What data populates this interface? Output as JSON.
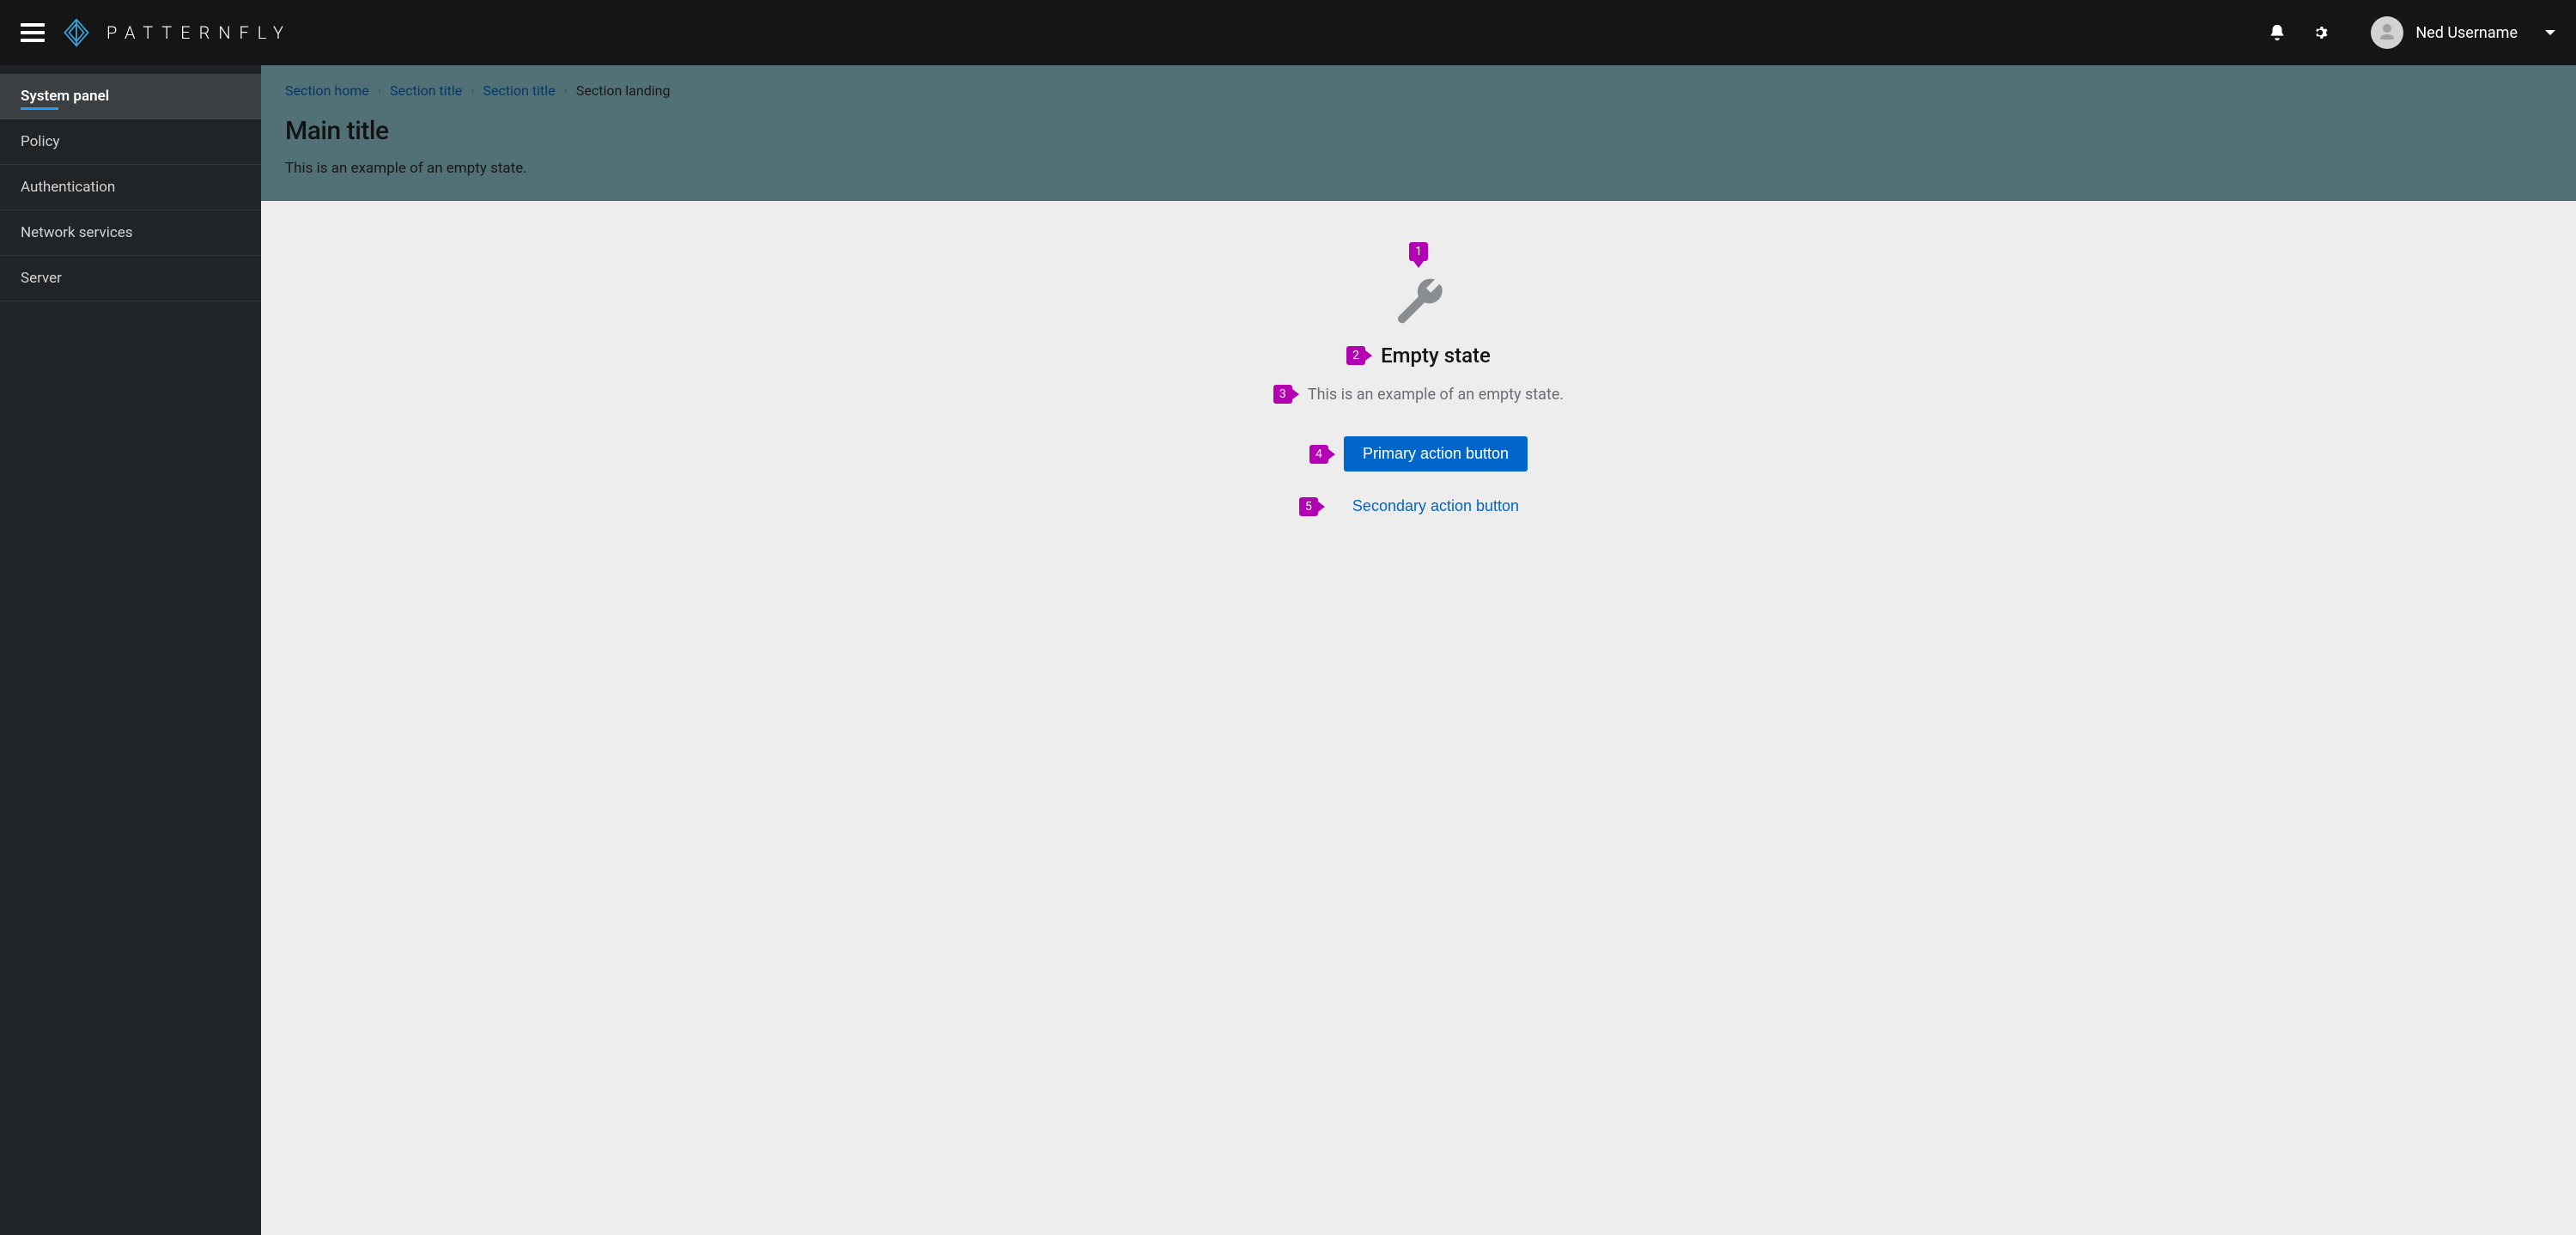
{
  "brand": {
    "name": "PATTERNFLY"
  },
  "header": {
    "user_name": "Ned Username"
  },
  "sidebar": {
    "items": [
      {
        "label": "System panel",
        "active": true
      },
      {
        "label": "Policy",
        "active": false
      },
      {
        "label": "Authentication",
        "active": false
      },
      {
        "label": "Network services",
        "active": false
      },
      {
        "label": "Server",
        "active": false
      }
    ]
  },
  "breadcrumb": {
    "items": [
      {
        "label": "Section home",
        "link": true
      },
      {
        "label": "Section title",
        "link": true
      },
      {
        "label": "Section title",
        "link": true
      },
      {
        "label": "Section landing",
        "link": false
      }
    ]
  },
  "page": {
    "title": "Main title",
    "subtitle": "This is an example of an empty state."
  },
  "empty_state": {
    "heading": "Empty state",
    "body": "This is an example of an empty state.",
    "primary_action": "Primary action button",
    "secondary_action": "Secondary action button"
  },
  "annotations": {
    "n1": "1",
    "n2": "2",
    "n3": "3",
    "n4": "4",
    "n5": "5"
  }
}
